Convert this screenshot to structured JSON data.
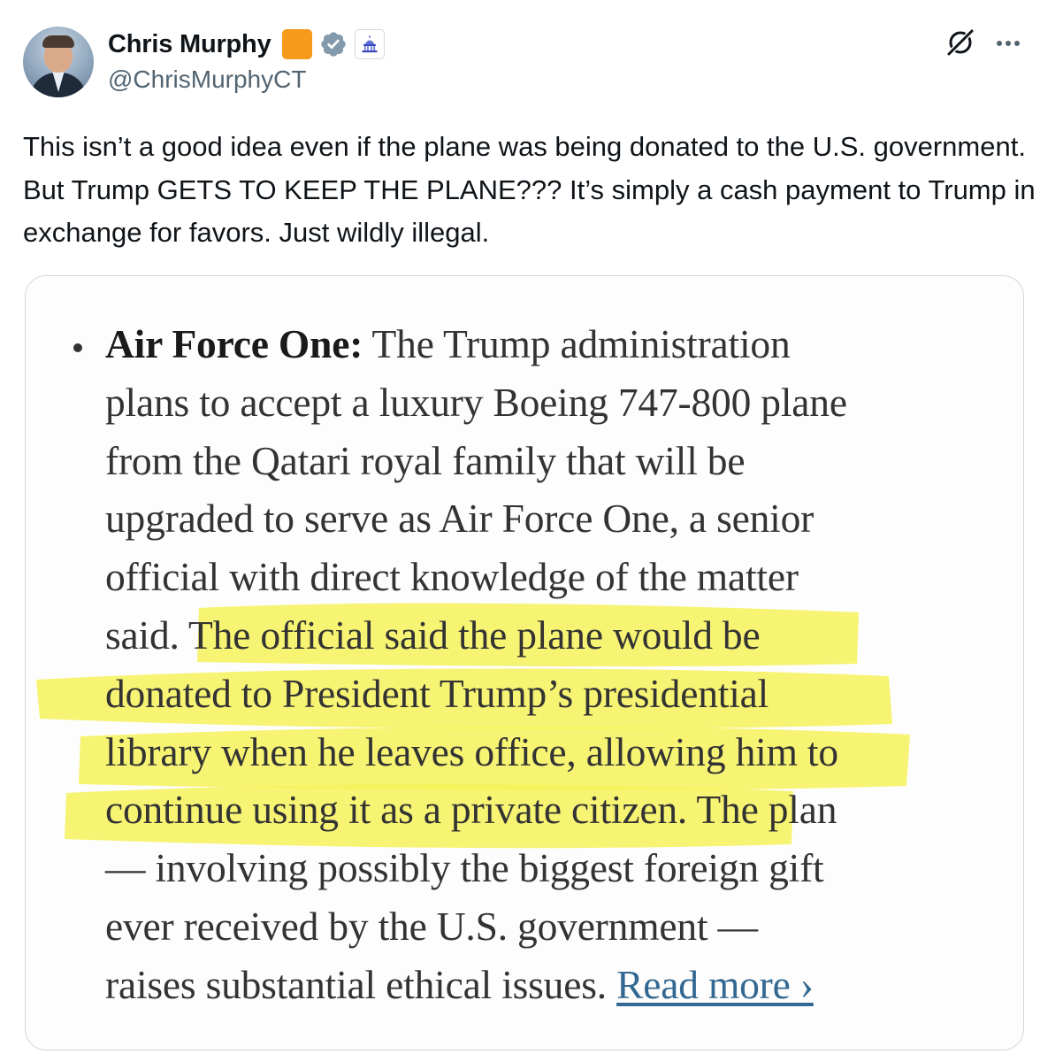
{
  "author": {
    "display_name": "Chris Murphy",
    "handle": "@ChrisMurphyCT",
    "badges": [
      "orange-square-badge",
      "verified-badge-icon",
      "capitol-building-icon"
    ]
  },
  "header_actions": {
    "icons": [
      "grok-icon",
      "more-options-icon"
    ]
  },
  "tweet": {
    "text": "This isn’t a good idea even if the plane was being donated to the U.S. government. But Trump GETS TO KEEP THE PLANE??? It’s simply a cash payment to Trump in exchange for favors. Just wildly illegal."
  },
  "article": {
    "bullet": "•",
    "lead": "Air Force One:",
    "lines": [
      "The Trump administration",
      "plans to accept a luxury Boeing 747-800 plane",
      "from the Qatari royal family that will be",
      "upgraded to serve as Air Force One, a senior",
      "official with direct knowledge of the matter",
      "said.",
      "The official said the plane would be",
      "donated to President Trump’s presidential",
      "library when he leaves office, allowing him to",
      "continue using it as a private citizen.",
      "The plan",
      "— involving possibly the biggest foreign gift",
      "ever received by the U.S. government —",
      "raises substantial ethical issues."
    ],
    "read_more": "Read more ›",
    "highlight_color": "#f6f25a",
    "link_color": "#326891"
  },
  "colors": {
    "text": "#0f1419",
    "secondary": "#536471",
    "border": "#cfd9de",
    "verified": "#829aab",
    "orange_badge": "#f79a1c"
  }
}
